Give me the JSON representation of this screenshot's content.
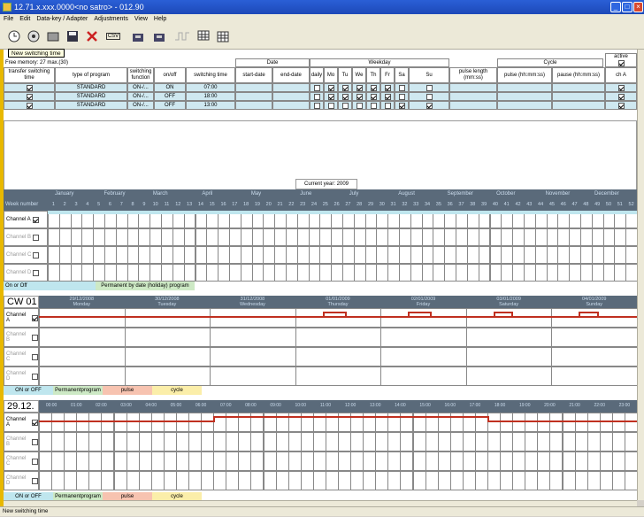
{
  "window": {
    "title": "12.71.x.xxx.0000<no satro> - 012.90"
  },
  "menu": [
    "File",
    "Edit",
    "Data-key / Adapter",
    "Adjustments",
    "View",
    "Help"
  ],
  "toolbar": {
    "tooltip": "New switching time",
    "csv_label": "CSV",
    "adapter_label": "ADAPTER",
    "net_label": "NET"
  },
  "table": {
    "free_memory": "Free memory: 27  max.(30)",
    "group_date": "Date",
    "group_weekday": "Weekday",
    "group_cycle": "Cycle",
    "group_active": "active",
    "columns": [
      "transfer switching time",
      "type of program",
      "switching function",
      "on/off",
      "switching time",
      "start-date",
      "end-date",
      "daily",
      "Mo",
      "Tu",
      "We",
      "Th",
      "Fr",
      "Sa",
      "Su",
      "pulse length (mm:ss)",
      "pulse (hh:mm:ss)",
      "pause (hh:mm:ss)",
      "ch A"
    ],
    "rows": [
      {
        "type": "STANDARD",
        "function": "ON-/...",
        "onoff": "ON",
        "time": "07:00",
        "days": [
          false,
          true,
          true,
          true,
          true,
          true,
          false,
          false
        ]
      },
      {
        "type": "STANDARD",
        "function": "ON-/...",
        "onoff": "OFF",
        "time": "18:00",
        "days": [
          false,
          true,
          true,
          true,
          true,
          true,
          false,
          false
        ]
      },
      {
        "type": "STANDARD",
        "function": "ON-/...",
        "onoff": "OFF",
        "time": "13:00",
        "days": [
          false,
          false,
          false,
          false,
          false,
          false,
          true,
          true
        ]
      }
    ]
  },
  "year_panel": {
    "current_year": "Current year: 2009",
    "week_number_label": "Week number",
    "months": [
      "January",
      "February",
      "March",
      "April",
      "May",
      "June",
      "July",
      "August",
      "September",
      "October",
      "November",
      "December"
    ],
    "weeks": [
      "1",
      "2",
      "3",
      "4",
      "5",
      "6",
      "7",
      "8",
      "9",
      "10",
      "11",
      "12",
      "13",
      "14",
      "15",
      "16",
      "17",
      "18",
      "19",
      "20",
      "21",
      "22",
      "23",
      "24",
      "25",
      "26",
      "27",
      "28",
      "29",
      "30",
      "31",
      "32",
      "33",
      "34",
      "35",
      "36",
      "37",
      "38",
      "39",
      "40",
      "41",
      "42",
      "43",
      "44",
      "45",
      "46",
      "47",
      "48",
      "49",
      "50",
      "51",
      "52"
    ],
    "channels": [
      "Channel A",
      "Channel B",
      "Channel C",
      "Channel D"
    ],
    "legend_onoff": "On or Off",
    "legend_perm": "Permanent by date (holiday) program"
  },
  "week_panel": {
    "label": "CW 01",
    "days": [
      {
        "date": "29/12/2008",
        "day": "Monday"
      },
      {
        "date": "30/12/2008",
        "day": "Tuesday"
      },
      {
        "date": "31/12/2008",
        "day": "Wednesday"
      },
      {
        "date": "01/01/2009",
        "day": "Thursday"
      },
      {
        "date": "02/01/2009",
        "day": "Friday"
      },
      {
        "date": "03/01/2009",
        "day": "Saturday"
      },
      {
        "date": "04/01/2009",
        "day": "Sunday"
      }
    ],
    "channels": [
      "Channel A",
      "Channel B",
      "Channel C",
      "Channel D"
    ],
    "legend": [
      "ON or OFF",
      "Permanentprogram",
      "pulse",
      "cycle"
    ]
  },
  "day_panel": {
    "label": "29.12.",
    "hours": [
      "00:00",
      "01:00",
      "02:00",
      "03:00",
      "04:00",
      "05:00",
      "06:00",
      "07:00",
      "08:00",
      "09:00",
      "10:00",
      "11:00",
      "12:00",
      "13:00",
      "14:00",
      "15:00",
      "16:00",
      "17:00",
      "18:00",
      "19:00",
      "20:00",
      "21:00",
      "22:00",
      "23:00"
    ],
    "channels": [
      "Channel A",
      "Channel B",
      "Channel C",
      "Channel D"
    ],
    "legend": [
      "ON or OFF",
      "Permanentprogram",
      "pulse",
      "cycle"
    ]
  },
  "status": {
    "text": "New switching time"
  },
  "colors": {
    "title": "#1d49b8",
    "accent": "#e8b800",
    "highlight": "#cfe8f0",
    "onbar": "#c03020"
  }
}
